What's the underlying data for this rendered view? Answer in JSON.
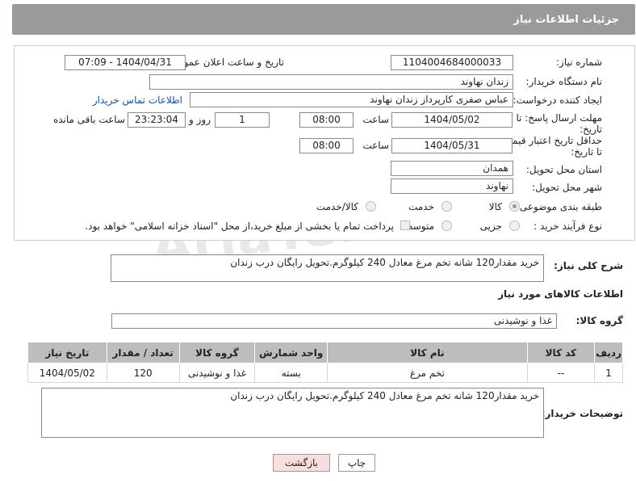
{
  "header": {
    "title": "جزئیات اطلاعات نیاز"
  },
  "watermark": {
    "text": "AriaTender.neT"
  },
  "form": {
    "need_number": {
      "label": "شماره نیاز:",
      "value": "1104004684000033"
    },
    "announce_datetime": {
      "label": "تاریخ و ساعت اعلان عمومی:",
      "value": "1404/04/31 - 07:09"
    },
    "buyer_org": {
      "label": "نام دستگاه خریدار:",
      "value": "زندان نهاوند"
    },
    "requester": {
      "label": "ایجاد کننده درخواست:",
      "value": "عباس صفری کارپرداز زندان نهاوند",
      "contact_link": "اطلاعات تماس خریدار"
    },
    "reply_deadline": {
      "label_line1": "مهلت ارسال پاسخ: تا",
      "label_line2": "تاریخ:",
      "date": "1404/05/02",
      "time_label": "ساعت",
      "time": "08:00",
      "days": "1",
      "days_label": "روز و",
      "remaining": "23:23:04",
      "remaining_label": "ساعت باقی مانده"
    },
    "price_validity": {
      "label_line1": "حداقل تاریخ اعتبار قیمت:",
      "label_line2": "تا تاریخ:",
      "date": "1404/05/31",
      "time_label": "ساعت",
      "time": "08:00"
    },
    "delivery_province": {
      "label": "استان محل تحویل:",
      "value": "همدان"
    },
    "delivery_city": {
      "label": "شهر محل تحویل:",
      "value": "نهاوند"
    },
    "category": {
      "label": "طبقه بندی موضوعی:",
      "options": [
        "کالا",
        "خدمت",
        "کالا/خدمت"
      ],
      "selected": "کالا"
    },
    "purchase_process": {
      "label": "نوع فرآیند خرید :",
      "options": [
        "جزیی",
        "متوسط"
      ],
      "selected": "جزیی",
      "payment_note": "پرداخت تمام یا بخشی از مبلغ خرید،از محل \"اسناد خزانه اسلامی\" خواهد بود."
    }
  },
  "summary": {
    "label": "شرح کلی نیاز:",
    "value": "خرید مقدار120 شانه تخم مرغ معادل 240 کیلوگرم.تحویل رایگان درب زندان"
  },
  "goods_section": {
    "title": "اطلاعات کالاهای مورد نیاز",
    "group_label": "گروه کالا:",
    "group_value": "غذا و نوشیدنی",
    "columns": [
      "ردیف",
      "کد کالا",
      "نام کالا",
      "واحد شمارش",
      "گروه کالا",
      "تعداد / مقدار",
      "تاریخ نیاز"
    ],
    "rows": [
      [
        "1",
        "--",
        "تخم مرغ",
        "بسته",
        "غذا و نوشیدنی",
        "120",
        "1404/05/02"
      ]
    ]
  },
  "buyer_notes": {
    "label": "توضیحات خریدار:",
    "value": "خرید مقدار120 شانه تخم مرغ معادل 240 کیلوگرم.تحویل رایگان درب زندان"
  },
  "buttons": {
    "print": "چاپ",
    "back": "بازگشت"
  },
  "colors": {
    "header_bg": "#9a9a9a",
    "table_header_bg": "#bdbdbd",
    "back_button_bg": "#f8dede",
    "link": "#1a4fa3"
  }
}
